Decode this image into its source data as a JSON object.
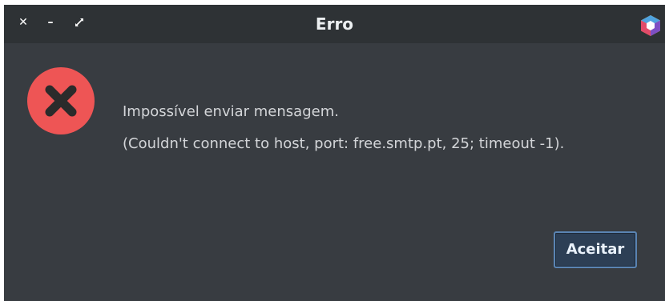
{
  "window": {
    "title": "Erro",
    "controls": {
      "close": "✕",
      "minimize": "–",
      "maximize": "⤢"
    }
  },
  "dialog": {
    "message_line1": "Impossível enviar mensagem.",
    "message_line2": "(Couldn't connect to host, port: free.smtp.pt, 25; timeout -1).",
    "accept_label": "Aceitar"
  },
  "colors": {
    "background": "#383c41",
    "error_red": "#ee5555",
    "button_border": "#5a84b3"
  },
  "icons": [
    "close-icon",
    "minimize-icon",
    "maximize-icon",
    "app-logo-icon",
    "error-icon"
  ]
}
